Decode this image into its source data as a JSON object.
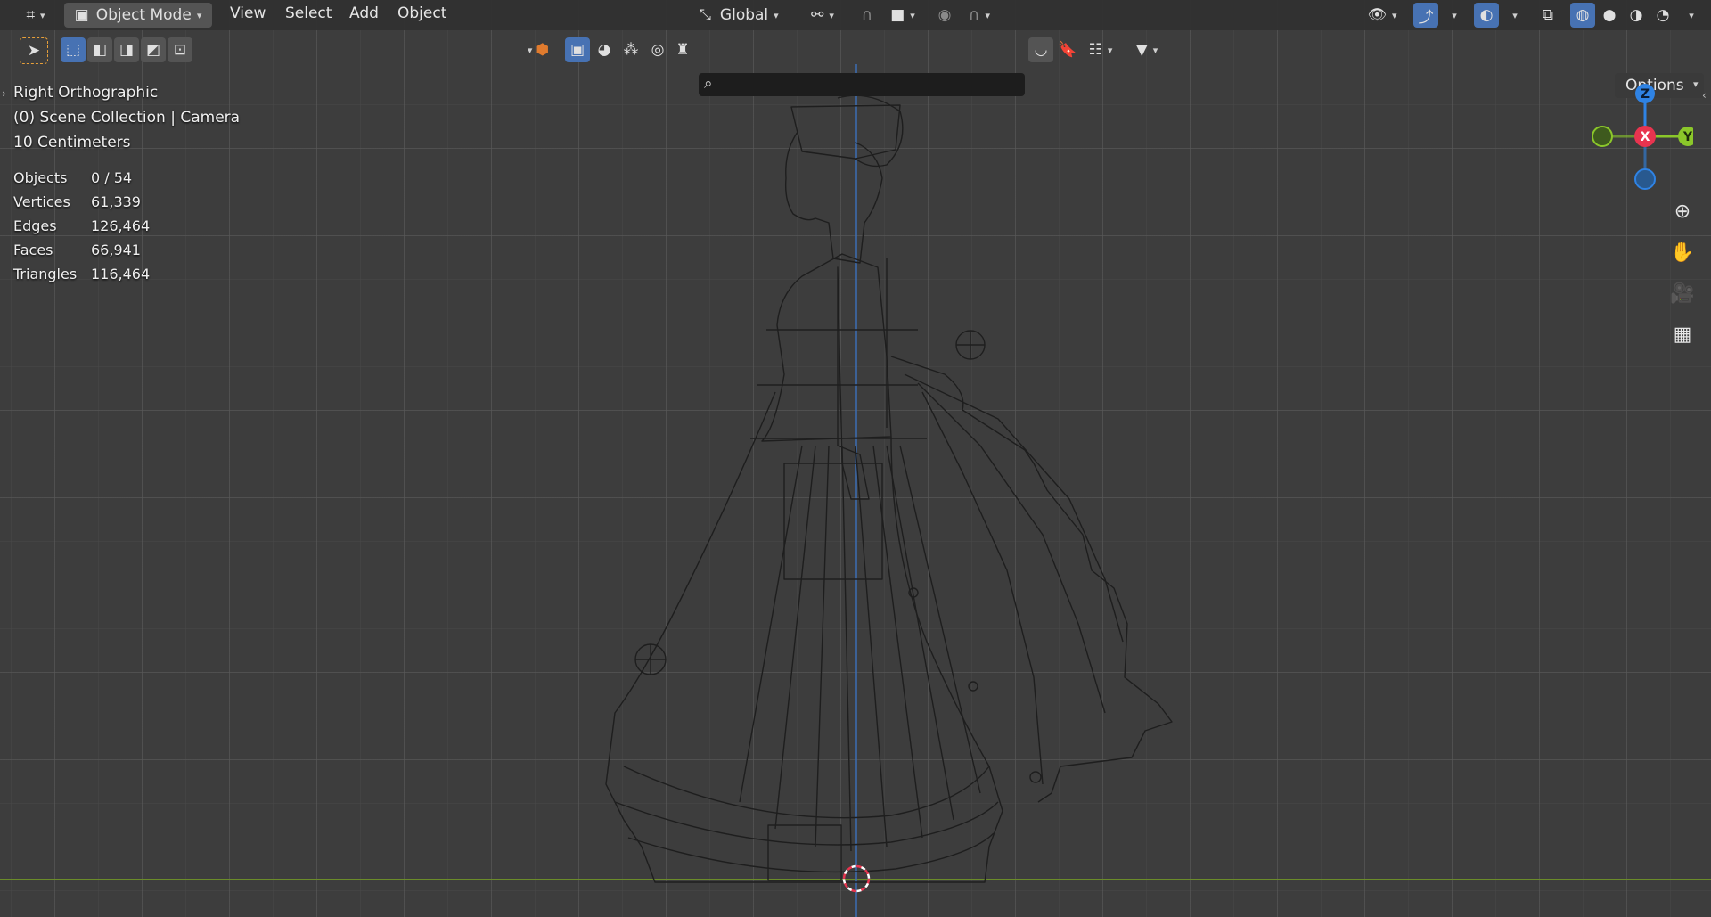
{
  "header": {
    "mode_label": "Object Mode",
    "menus": [
      "View",
      "Select",
      "Add",
      "Object"
    ],
    "transform_orientation": "Global",
    "options_label": "Options"
  },
  "viewport_info": {
    "view_name": "Right Orthographic",
    "collection": "(0) Scene Collection | Camera",
    "grid_scale": "10 Centimeters"
  },
  "stats": [
    {
      "label": "Objects",
      "value": "0 / 54"
    },
    {
      "label": "Vertices",
      "value": "61,339"
    },
    {
      "label": "Edges",
      "value": "126,464"
    },
    {
      "label": "Faces",
      "value": "66,941"
    },
    {
      "label": "Triangles",
      "value": "116,464"
    }
  ],
  "gizmo": {
    "z": "Z",
    "x": "X",
    "y": "Y"
  },
  "colors": {
    "accent": "#4772b3",
    "x_axis": "#e8344f",
    "y_axis": "#8bc72a",
    "z_axis": "#2f83e4"
  }
}
